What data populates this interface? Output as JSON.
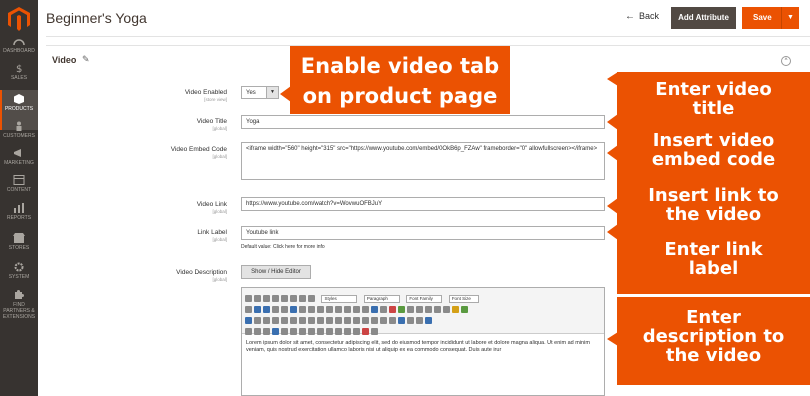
{
  "sidebar": {
    "items": [
      {
        "label": "DASHBOARD"
      },
      {
        "label": "SALES"
      },
      {
        "label": "PRODUCTS"
      },
      {
        "label": "CUSTOMERS"
      },
      {
        "label": "MARKETING"
      },
      {
        "label": "CONTENT"
      },
      {
        "label": "REPORTS"
      },
      {
        "label": "STORES"
      },
      {
        "label": "SYSTEM"
      },
      {
        "label": "FIND PARTNERS & EXTENSIONS"
      }
    ],
    "active": "PRODUCTS"
  },
  "header": {
    "title": "Beginner's Yoga",
    "back_label": "Back",
    "add_attribute_label": "Add Attribute",
    "save_label": "Save"
  },
  "section": {
    "title": "Video"
  },
  "form": {
    "video_enabled": {
      "label": "Video Enabled",
      "scope": "[store view]",
      "value": "Yes"
    },
    "video_title": {
      "label": "Video Title",
      "scope": "[global]",
      "value": "Yoga"
    },
    "video_embed": {
      "label": "Video Embed Code",
      "scope": "[global]",
      "value": "<iframe width=\"560\" height=\"315\" src=\"https://www.youtube.com/embed/0OkB6p_FZAw\" frameborder=\"0\" allowfullscreen></iframe>"
    },
    "video_link": {
      "label": "Video Link",
      "scope": "[global]",
      "value": "https://www.youtube.com/watch?v=WovwuOFBJuY"
    },
    "link_label": {
      "label": "Link Label",
      "scope": "[global]",
      "value": "Youtube link",
      "note": "Default value: Click here for more info"
    },
    "video_description": {
      "label": "Video Description",
      "scope": "[global]",
      "editor_button": "Show / Hide Editor",
      "toolbar_selects": [
        "Styles",
        "Paragraph",
        "Font Family",
        "Font Size"
      ],
      "content": "Lorem ipsum dolor sit amet, consectetur adipiscing elit, sed do eiusmod tempor incididunt ut labore et dolore magna aliqua. Ut enim ad minim veniam, quis nostrud exercitation ullamco laboris nisi ut aliquip ex ea commodo consequat. Duis aute irur"
    }
  },
  "callouts": {
    "enable": [
      "Enable video tab",
      "on product page"
    ],
    "title": [
      "Enter video",
      "title"
    ],
    "embed": [
      "Insert video",
      "embed code"
    ],
    "link": [
      "Insert link to",
      "the video"
    ],
    "label": [
      "Enter link",
      "label"
    ],
    "description": [
      "Enter",
      "description to",
      "the video"
    ]
  },
  "colors": {
    "accent": "#eb5202",
    "sidebar": "#373330",
    "add_attribute_bg": "#514943"
  }
}
